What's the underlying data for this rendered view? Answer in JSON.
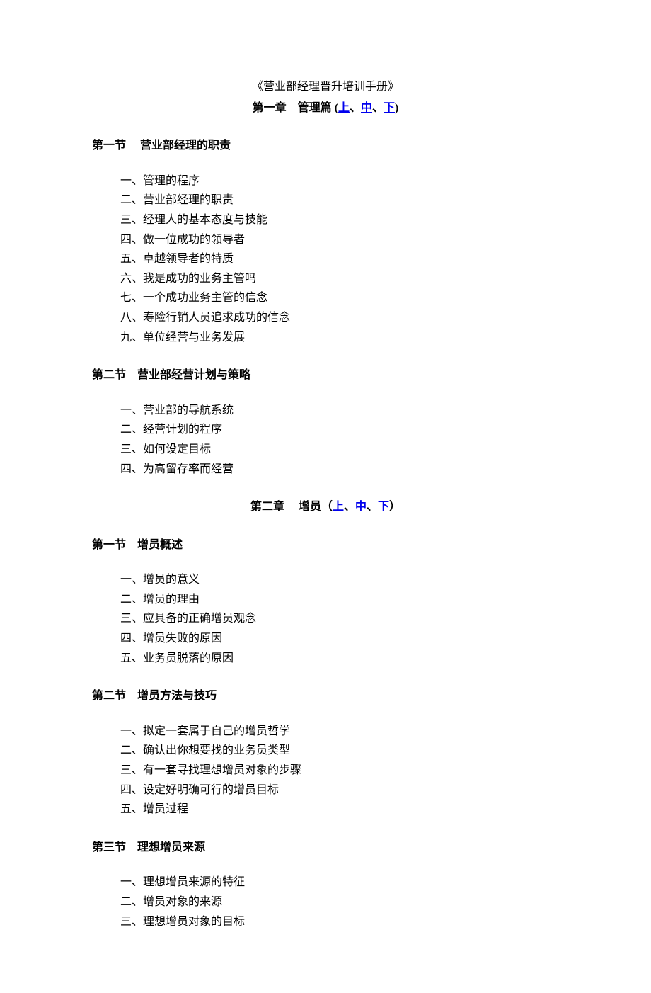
{
  "title": "《营业部经理晋升培训手册》",
  "chapter1": {
    "prefix": "第一章　管理篇 (",
    "link1": "上",
    "link2": "中",
    "link3": "下",
    "suffix": ")",
    "sep": "、"
  },
  "c1s1": {
    "title": "第一节　 营业部经理的职责",
    "items": [
      "一、管理的程序",
      "二、营业部经理的职责",
      "三、经理人的基本态度与技能",
      "四、做一位成功的领导者",
      "五、卓越领导者的特质",
      "六、我是成功的业务主管吗",
      "七、一个成功业务主管的信念",
      "八、寿险行销人员追求成功的信念",
      "九、单位经营与业务发展"
    ]
  },
  "c1s2": {
    "title": "第二节　营业部经营计划与策略",
    "items": [
      "一、营业部的导航系统",
      "二、经营计划的程序",
      "三、如何设定目标",
      "四、为高留存率而经营"
    ]
  },
  "chapter2": {
    "prefix": "第二章　 增员（",
    "link1": "上",
    "link2": "中",
    "link3": "下",
    "suffix": "）",
    "sep": "、"
  },
  "c2s1": {
    "title": "第一节　增员概述",
    "items": [
      "一、增员的意义",
      "二、增员的理由",
      "三、应具备的正确增员观念",
      "四、增员失败的原因",
      "五、业务员脱落的原因"
    ]
  },
  "c2s2": {
    "title": "第二节　增员方法与技巧",
    "items": [
      "一、拟定一套属于自己的增员哲学",
      "二、确认出你想要找的业务员类型",
      "三、有一套寻找理想增员对象的步骤",
      "四、设定好明确可行的增员目标",
      "五、增员过程"
    ]
  },
  "c2s3": {
    "title": "第三节　理想增员来源",
    "items": [
      "一、理想增员来源的特征",
      "二、增员对象的来源",
      "三、理想增员对象的目标"
    ]
  }
}
